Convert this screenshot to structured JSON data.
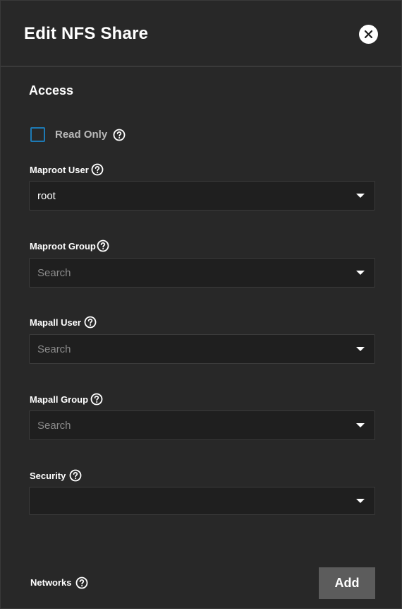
{
  "header": {
    "title": "Edit NFS Share",
    "close_icon": "close-icon"
  },
  "section": {
    "title": "Access"
  },
  "read_only": {
    "label": "Read Only",
    "checked": false
  },
  "fields": {
    "maproot_user": {
      "label": "Maproot User",
      "value": "root"
    },
    "maproot_group": {
      "label": "Maproot Group",
      "placeholder": "Search"
    },
    "mapall_user": {
      "label": "Mapall User",
      "placeholder": "Search"
    },
    "mapall_group": {
      "label": "Mapall Group",
      "placeholder": "Search"
    },
    "security": {
      "label": "Security",
      "value": ""
    }
  },
  "networks": {
    "label": "Networks",
    "add_label": "Add"
  },
  "colors": {
    "background": "#282828",
    "field_background": "#1f1f1f",
    "checkbox_border": "#1d7ab5",
    "add_button": "#5c5c5c"
  }
}
